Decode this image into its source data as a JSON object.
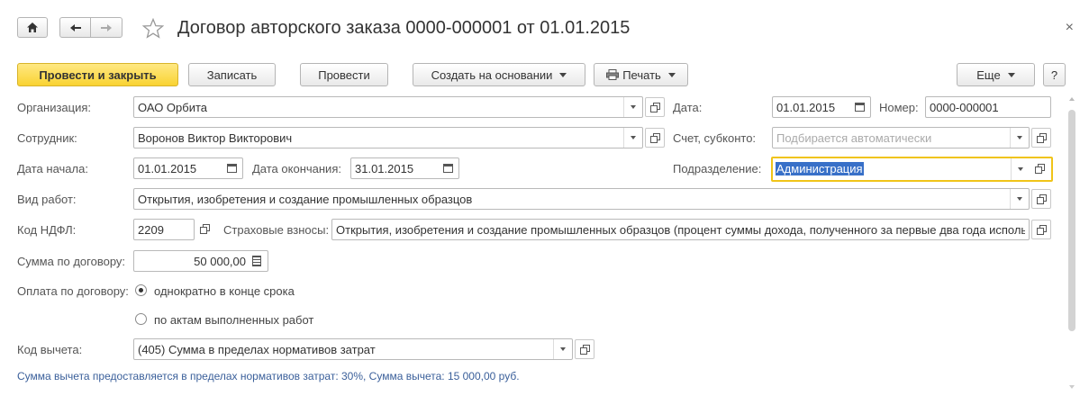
{
  "window": {
    "title": "Договор авторского заказа 0000-000001 от 01.01.2015",
    "close_symbol": "×"
  },
  "toolbar": {
    "post_and_close": "Провести и закрыть",
    "save": "Записать",
    "post": "Провести",
    "create_based_on": "Создать на основании",
    "print": "Печать",
    "more": "Еще",
    "help": "?"
  },
  "form": {
    "organization": {
      "label": "Организация:",
      "value": "ОАО Орбита"
    },
    "date": {
      "label": "Дата:",
      "value": "01.01.2015"
    },
    "number": {
      "label": "Номер:",
      "value": "0000-000001"
    },
    "employee": {
      "label": "Сотрудник:",
      "value": "Воронов Виктор Викторович"
    },
    "account": {
      "label": "Счет, субконто:",
      "placeholder": "Подбирается автоматически"
    },
    "start_date": {
      "label": "Дата начала:",
      "value": "01.01.2015"
    },
    "end_date": {
      "label": "Дата окончания:",
      "value": "31.01.2015"
    },
    "department": {
      "label": "Подразделение:",
      "value": "Администрация"
    },
    "work_type": {
      "label": "Вид работ:",
      "value": "Открытия, изобретения и создание промышленных образцов"
    },
    "ndfl_code": {
      "label": "Код НДФЛ:",
      "value": "2209"
    },
    "insurance": {
      "label": "Страховые взносы:",
      "value": "Открытия, изобретения и создание промышленных образцов (процент суммы дохода, полученного за первые два года использ"
    },
    "contract_sum": {
      "label": "Сумма по договору:",
      "value": "50 000,00"
    },
    "payment": {
      "label": "Оплата по договору:",
      "options": [
        {
          "label": "однократно в конце срока",
          "selected": true
        },
        {
          "label": "по актам выполненных работ",
          "selected": false
        }
      ]
    },
    "deduction_code": {
      "label": "Код вычета:",
      "value": "(405) Сумма в пределах нормативов затрат"
    },
    "info_text": "Сумма вычета предоставляется в пределах нормативов затрат: 30%,  Сумма вычета: 15 000,00 руб."
  },
  "colors": {
    "primary_button": "#f9d332",
    "focus_border": "#f0c419",
    "selection": "#3870c8",
    "info_text": "#3a5f9a"
  }
}
